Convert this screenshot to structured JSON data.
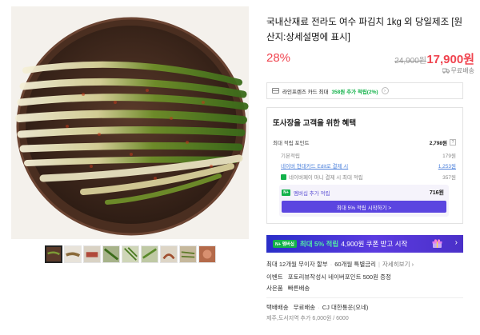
{
  "product": {
    "title": "국내산재료 전라도 여수 파김치 1kg 외 당일제조 [원산지:상세설명에 표시]",
    "discount_rate": "28%",
    "original_price": "24,900원",
    "sale_price": "17,900원",
    "shipping_badge": "무료배송"
  },
  "card_promo": {
    "text_prefix": "라인프렌즈 카드 최대",
    "text_highlight": "358원 추가 적립(2%)",
    "text_suffix": ""
  },
  "benefits": {
    "title": "또사장을 고객을 위한 혜택",
    "max_points_label": "최대 적립 포인트",
    "max_points_value": "2,798원",
    "help_icon": "?",
    "rows": [
      {
        "label": "기본적립",
        "value": "179원"
      },
      {
        "label": "네이버 현대카드 Edit로 결제 시",
        "value": "1,253원"
      },
      {
        "label": "네이버페이 머니 결제 시 최대 적립",
        "value": "357원"
      }
    ],
    "membership_label": "멤버십 추가 적립",
    "membership_value": "716원",
    "membership_button": "최대 5% 적립 시작하기 >"
  },
  "coupon_banner": {
    "badge": "N+ 멤버십",
    "highlight": "최대 5% 적립",
    "text": "4,900원 쿠폰 받고 시작",
    "arrow": "›"
  },
  "details": {
    "install_label": "최대 12개월 무이자 할부",
    "install_extra": "60개월 특별금리",
    "install_link": "자세히보기",
    "event_label": "이벤트",
    "event_text": "포토리뷰작성시 네이버포인트 500원 증정",
    "gift_label": "사은품",
    "gift_text": "빠른배송",
    "ship_label": "택배배송",
    "ship_type": "무료배송",
    "ship_company": "CJ 대한통운(오네)",
    "jeju_text": "제주,도서지역 추가 6,000원 / 6000"
  },
  "icons": {
    "truck": "truck-icon",
    "card": "card-icon",
    "gift": "gift-icon"
  },
  "colors": {
    "price_red": "#f0444f",
    "naver_green": "#13b24a",
    "membership_purple": "#5b45e0"
  }
}
